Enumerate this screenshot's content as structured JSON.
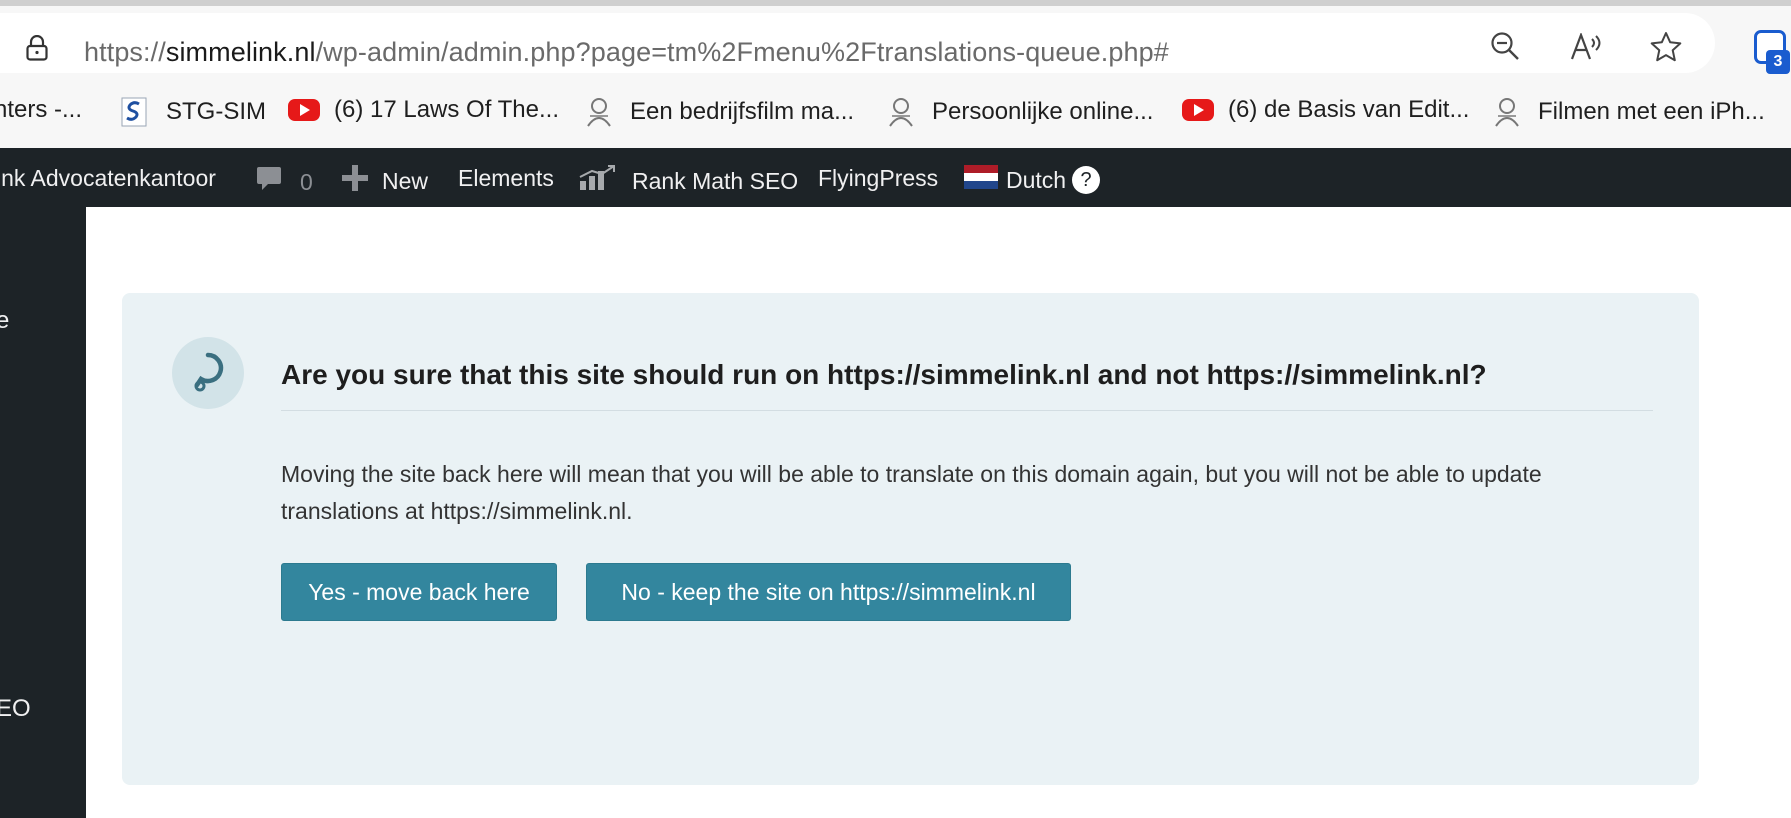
{
  "browser": {
    "url_scheme": "https://",
    "url_host": "simmelink.nl",
    "url_path": "/wp-admin/admin.php?page=tm%2Fmenu%2Ftranslations-queue.php#",
    "extension_badge": "3"
  },
  "bookmarks": [
    {
      "label": "nters -...",
      "icon": "none"
    },
    {
      "label": "STG-SIM",
      "icon": "stg-logo-icon"
    },
    {
      "label": "(6) 17 Laws Of The...",
      "icon": "youtube-icon"
    },
    {
      "label": "Een bedrijfsfilm ma...",
      "icon": "site-logo-icon"
    },
    {
      "label": "Persoonlijke online...",
      "icon": "site-logo-icon"
    },
    {
      "label": "(6) de Basis van Edit...",
      "icon": "youtube-icon"
    },
    {
      "label": "Filmen met een iPh...",
      "icon": "site-logo-icon"
    }
  ],
  "admin_bar": {
    "site_name": "ink Advocatenkantoor",
    "comments_count": "0",
    "new_label": "New",
    "elements_label": "Elements",
    "rankmath_label": "Rank Math SEO",
    "flyingpress_label": "FlyingPress",
    "language_label": "Dutch",
    "help_label": "?"
  },
  "sidebar": {
    "item_top": "e",
    "item_bottom": "EO"
  },
  "notice": {
    "heading": "Are you sure that this site should run on https://simmelink.nl and not https://simmelink.nl?",
    "body": "Moving the site back here will mean that you will be able to translate on this domain again, but you will not be able to update translations at https://simmelink.nl.",
    "yes_button": "Yes - move back here",
    "no_button": "No - keep the site on https://simmelink.nl"
  },
  "colors": {
    "admin_bar_bg": "#1d2327",
    "notice_bg": "#eaf2f5",
    "button_bg": "#33869e",
    "youtube_red": "#e61919"
  }
}
